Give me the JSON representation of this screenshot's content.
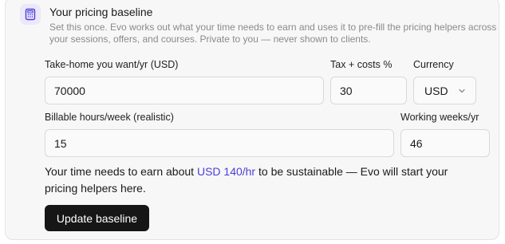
{
  "section": {
    "title": "Your pricing baseline",
    "description": "Set this once. Evo works out what your time needs to earn and uses it to pre-fill the pricing helpers across your sessions, offers, and courses. Private to you — never shown to clients.",
    "icon": "calculator-icon"
  },
  "fields": {
    "take_home": {
      "label": "Take-home you want/yr (USD)",
      "value": "70000"
    },
    "tax_costs": {
      "label": "Tax + costs %",
      "value": "30"
    },
    "currency": {
      "label": "Currency",
      "value": "USD"
    },
    "billable_hours": {
      "label": "Billable hours/week (realistic)",
      "value": "15"
    },
    "working_weeks": {
      "label": "Working weeks/yr",
      "value": "46"
    }
  },
  "summary": {
    "prefix": "Your time needs to earn about",
    "rate": "USD 140/hr",
    "suffix": "to be sustainable — Evo will start your pricing helpers here."
  },
  "actions": {
    "update_label": "Update baseline"
  },
  "colors": {
    "accent": "#4b3fd9",
    "button": "#161616",
    "card_bg": "#f7f7f7"
  }
}
